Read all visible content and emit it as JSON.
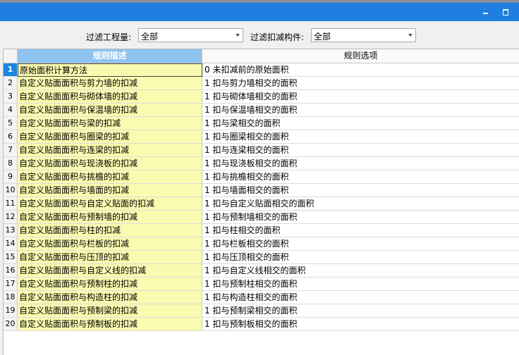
{
  "window": {
    "minimize_label": "",
    "maximize_label": ""
  },
  "filters": {
    "quantity_label": "过滤工程量:",
    "quantity_value": "全部",
    "component_label": "过滤扣减构件:",
    "component_value": "全部"
  },
  "grid": {
    "headers": {
      "rownum": "",
      "description": "规则描述",
      "option": "规则选项"
    },
    "selected_row": 1,
    "rows": [
      {
        "n": "1",
        "desc": "原始面积计算方法",
        "opt": "0  未扣减前的原始面积"
      },
      {
        "n": "2",
        "desc": "自定义贴面面积与剪力墙的扣减",
        "opt": "1  扣与剪力墙相交的面积"
      },
      {
        "n": "3",
        "desc": "自定义贴面面积与砌体墙的扣减",
        "opt": "1  扣与砌体墙相交的面积"
      },
      {
        "n": "4",
        "desc": "自定义贴面面积与保温墙的扣减",
        "opt": "1  扣与保温墙相交的面积"
      },
      {
        "n": "5",
        "desc": "自定义贴面面积与梁的扣减",
        "opt": "1  扣与梁相交的面积"
      },
      {
        "n": "6",
        "desc": "自定义贴面面积与圈梁的扣减",
        "opt": "1  扣与圈梁相交的面积"
      },
      {
        "n": "7",
        "desc": "自定义贴面面积与连梁的扣减",
        "opt": "1  扣与连梁相交的面积"
      },
      {
        "n": "8",
        "desc": "自定义贴面面积与现浇板的扣减",
        "opt": "1  扣与现浇板相交的面积"
      },
      {
        "n": "9",
        "desc": "自定义贴面面积与挑檐的扣减",
        "opt": "1  扣与挑檐相交的面积"
      },
      {
        "n": "10",
        "desc": "自定义贴面面积与墙面的扣减",
        "opt": "1  扣与墙面相交的面积"
      },
      {
        "n": "11",
        "desc": "自定义贴面面积与自定义贴面的扣减",
        "opt": "1  扣与自定义贴面相交的面积"
      },
      {
        "n": "12",
        "desc": "自定义贴面面积与预制墙的扣减",
        "opt": "1  扣与预制墙相交的面积"
      },
      {
        "n": "13",
        "desc": "自定义贴面面积与柱的扣减",
        "opt": "1  扣与柱相交的面积"
      },
      {
        "n": "14",
        "desc": "自定义贴面面积与栏板的扣减",
        "opt": "1  扣与栏板相交的面积"
      },
      {
        "n": "15",
        "desc": "自定义贴面面积与压顶的扣减",
        "opt": "1  扣与压顶相交的面积"
      },
      {
        "n": "16",
        "desc": "自定义贴面面积与自定义线的扣减",
        "opt": "1  扣与自定义线相交的面积"
      },
      {
        "n": "17",
        "desc": "自定义贴面面积与预制柱的扣减",
        "opt": "1  扣与预制柱相交的面积"
      },
      {
        "n": "18",
        "desc": "自定义贴面面积与构造柱的扣减",
        "opt": "1  扣与构造柱相交的面积"
      },
      {
        "n": "19",
        "desc": "自定义贴面面积与预制梁的扣减",
        "opt": "1  扣与预制梁相交的面积"
      },
      {
        "n": "20",
        "desc": "自定义贴面面积与预制板的扣减",
        "opt": "1  扣与预制板相交的面积"
      }
    ]
  }
}
